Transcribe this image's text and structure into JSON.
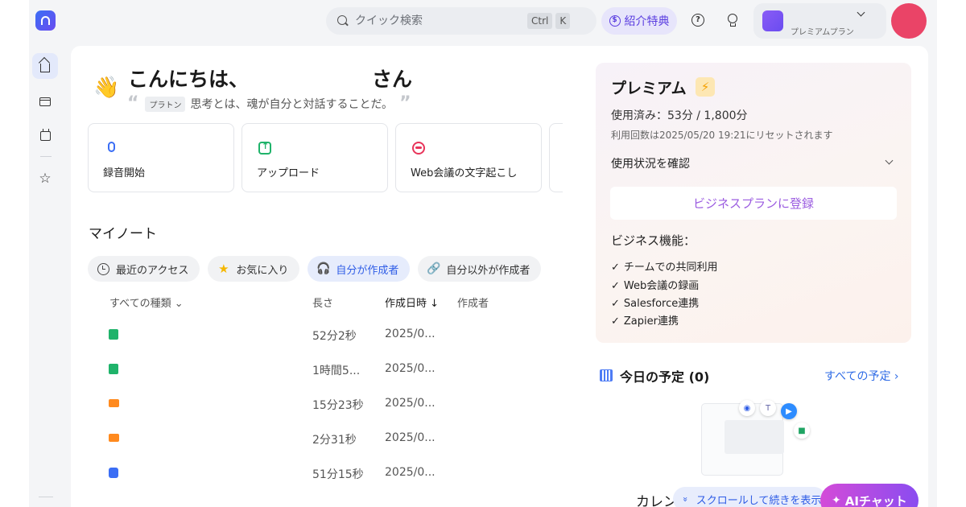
{
  "search": {
    "placeholder": "クイック検索",
    "kbd1": "Ctrl",
    "kbd2": "K"
  },
  "header": {
    "referral_label": "紹介特典",
    "plan_label": "プレミアムプラン"
  },
  "greeting": {
    "hello": "こんにちは、",
    "suffix": "さん",
    "tag": "プラトン",
    "quote": "思考とは、魂が自分と対話することだ。"
  },
  "actions": [
    {
      "label": "録音開始",
      "icon": "mic-icon"
    },
    {
      "label": "アップロード",
      "icon": "upload-icon"
    },
    {
      "label": "Web会議の文字起こし",
      "icon": "web-meeting-icon"
    }
  ],
  "notes": {
    "title": "マイノート",
    "filters": [
      {
        "label": "最近のアクセス",
        "icon": "clock-icon"
      },
      {
        "label": "お気に入り",
        "icon": "star-icon"
      },
      {
        "label": "自分が作成者",
        "icon": "headphone-icon"
      },
      {
        "label": "自分以外が作成者",
        "icon": "link-icon"
      }
    ],
    "columns": {
      "type": "すべての種類 ⌄",
      "length": "長さ",
      "date": "作成日時 ↓",
      "author": "作成者"
    },
    "rows": [
      {
        "type": "audio",
        "length": "52分2秒",
        "date": "2025/0..."
      },
      {
        "type": "audio",
        "length": "1時間5...",
        "date": "2025/0..."
      },
      {
        "type": "video",
        "length": "15分23秒",
        "date": "2025/0..."
      },
      {
        "type": "video",
        "length": "2分31秒",
        "date": "2025/0..."
      },
      {
        "type": "voice",
        "length": "51分15秒",
        "date": "2025/0..."
      }
    ]
  },
  "premium": {
    "title": "プレミアム",
    "used": "使用済み：53分 / 1,800分",
    "reset": "利用回数は2025/05/20 19:21にリセットされます",
    "check_usage": "使用状況を確認",
    "business_button": "ビジネスプランに登録",
    "business_title": "ビジネス機能：",
    "features": [
      "チームでの共同利用",
      "Web会議の録画",
      "Salesforce連携",
      "Zapier連携"
    ]
  },
  "schedule": {
    "title": "今日の予定 (0)",
    "all_link": "すべての予定 ›",
    "calendar_label": "カレン"
  },
  "footer": {
    "scroll_hint": "スクロールして続きを表示",
    "ai_chat": "AIチャット"
  },
  "colors": {
    "accent": "#2e5ce6",
    "avatar": "#ea4467",
    "ai_gradient_start": "#d44bd8",
    "ai_gradient_end": "#8a4cf0"
  }
}
